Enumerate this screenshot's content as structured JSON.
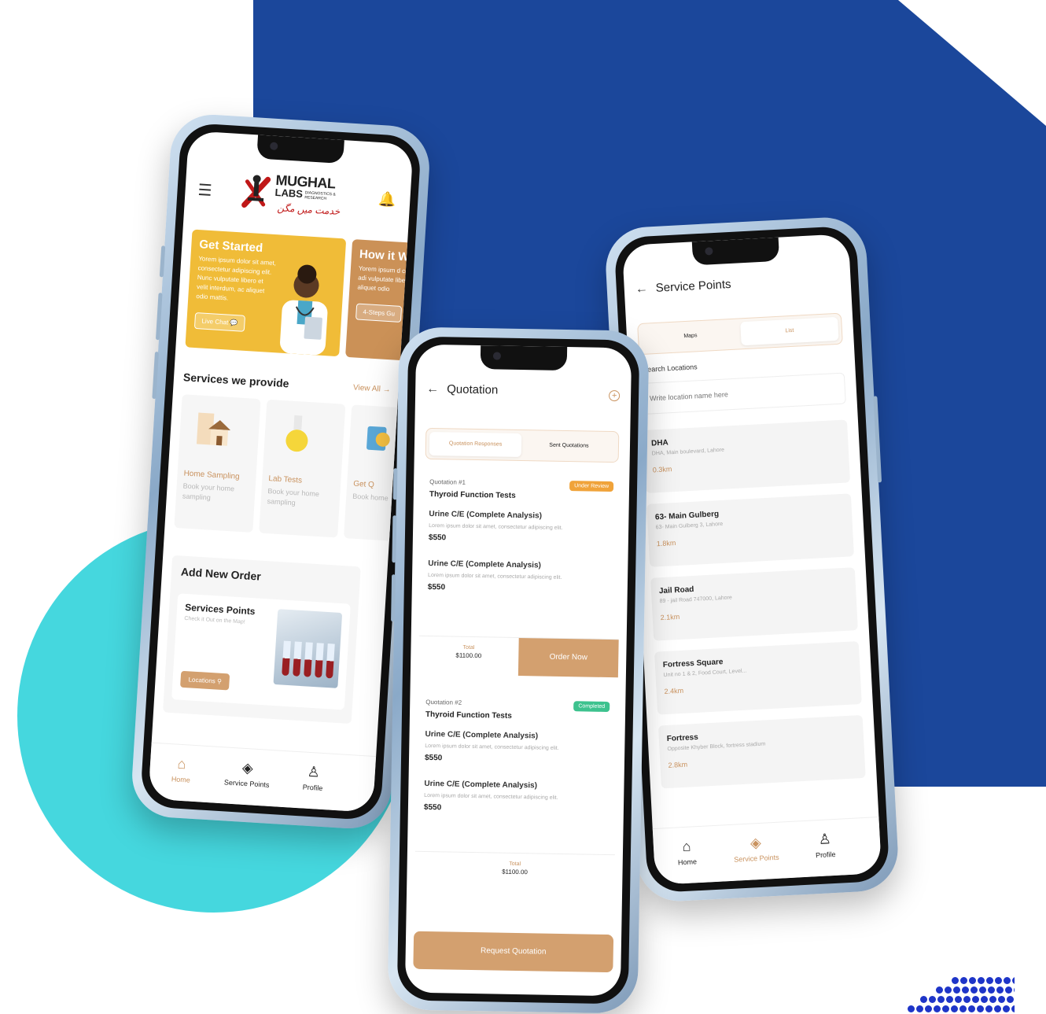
{
  "colors": {
    "blue_block": "#1b479b",
    "teal_circle": "#45d7de",
    "accent_brown": "#d3a06f",
    "card_yellow": "#f0bc38",
    "card_brown": "#cb9157",
    "badge_review": "#f0a33a",
    "badge_completed": "#3dc28e"
  },
  "home": {
    "logo": {
      "title": "MUGHAL",
      "subtitle": "LABS",
      "tagline_small": "DIAGNOSTICS & RESEARCH",
      "urdu": "خدمت میں مگن"
    },
    "icons": {
      "menu": "hamburger-menu-icon",
      "bell": "bell-icon"
    },
    "cards": [
      {
        "title": "Get Started",
        "text": "Yorem ipsum dolor sit amet, consectetur adipiscing elit. Nunc vulputate libero et velit interdum, ac aliquet odio mattis.",
        "button": "Live Chat"
      },
      {
        "title": "How it W",
        "text": "Yorem ipsum d consectetur adi vulputate libero ac aliquet odio",
        "button": "4-Steps Gu"
      }
    ],
    "services_title": "Services we provide",
    "view_all": "View All →",
    "services": [
      {
        "name": "Home Sampling",
        "desc": "Book your home sampling"
      },
      {
        "name": "Lab Tests",
        "desc": "Book your home sampling"
      },
      {
        "name": "Get Q",
        "desc": "Book home"
      }
    ],
    "add_order_title": "Add New Order",
    "service_points_card": {
      "title": "Services Points",
      "subtitle": "Check it Out on the Map!",
      "button": "Locations"
    },
    "nav": [
      {
        "label": "Home",
        "icon": "home-icon"
      },
      {
        "label": "Service Points",
        "icon": "target-icon"
      },
      {
        "label": "Profile",
        "icon": "user-icon"
      }
    ]
  },
  "quotation": {
    "title": "Quotation",
    "tabs": [
      "Quotation Responses",
      "Sent Quotations"
    ],
    "quotes": [
      {
        "number": "Quotation #1",
        "name": "Thyroid Function Tests",
        "status": "Under Review",
        "items": [
          {
            "name": "Urine C/E (Complete Analysis)",
            "desc": "Lorem ipsum dolor sit amet, consectetur adipiscing elit.",
            "price": "$550"
          },
          {
            "name": "Urine C/E (Complete Analysis)",
            "desc": "Lorem ipsum dolor sit amet, consectetur adipiscing elit.",
            "price": "$550"
          }
        ],
        "total_label": "Total",
        "total": "$1100.00",
        "action": "Order Now"
      },
      {
        "number": "Quotation #2",
        "name": "Thyroid Function Tests",
        "status": "Completed",
        "items": [
          {
            "name": "Urine C/E (Complete Analysis)",
            "desc": "Lorem ipsum dolor sit amet, consectetur adipiscing elit.",
            "price": "$550"
          },
          {
            "name": "Urine C/E (Complete Analysis)",
            "desc": "Lorem ipsum dolor sit amet, consectetur adipiscing elit.",
            "price": "$550"
          }
        ],
        "total_label": "Total",
        "total": "$1100.00"
      }
    ],
    "request_button": "Request Quotation"
  },
  "service_points": {
    "title": "Service Points",
    "tabs": [
      "Maps",
      "List"
    ],
    "search_label": "Search Locations",
    "search_placeholder": "Write location name here",
    "locations": [
      {
        "name": "DHA",
        "address": "DHA, Main boulevard, Lahore",
        "distance": "0.3km"
      },
      {
        "name": "63- Main Gulberg",
        "address": "63- Main Gulberg 3, Lahore",
        "distance": "1.8km"
      },
      {
        "name": "Jail Road",
        "address": "89 - jail Road 747000, Lahore",
        "distance": "2.1km"
      },
      {
        "name": "Fortress Square",
        "address": "Unit no 1 & 2, Food Court, Level...",
        "distance": "2.4km"
      },
      {
        "name": "Fortress",
        "address": "Opposite Khyber Block, fortress stadium",
        "distance": "2.8km"
      }
    ],
    "nav": [
      {
        "label": "Home",
        "icon": "home-icon"
      },
      {
        "label": "Service Points",
        "icon": "target-icon"
      },
      {
        "label": "Profile",
        "icon": "user-icon"
      }
    ]
  }
}
